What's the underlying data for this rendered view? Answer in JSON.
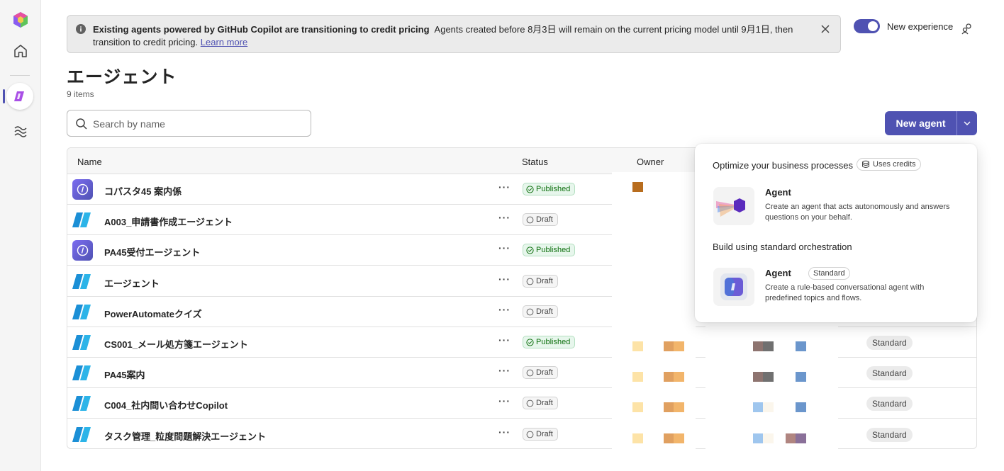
{
  "banner": {
    "title": "Existing agents powered by GitHub Copilot are transitioning to credit pricing",
    "message": "Agents created before 8月3日 will remain on the current pricing model until 9月1日, then transition to credit pricing.",
    "link": "Learn more"
  },
  "toggle": {
    "label": "New experience",
    "on": true
  },
  "page": {
    "title": "エージェント",
    "count": "9 items"
  },
  "search": {
    "placeholder": "Search by name"
  },
  "new_agent": {
    "label": "New agent"
  },
  "table": {
    "headers": {
      "name": "Name",
      "status": "Status",
      "owner": "Owner"
    },
    "rows": [
      {
        "name": "コパスタ45 案内係",
        "status": "Published",
        "kind": "pub",
        "orchestration": ""
      },
      {
        "name": "A003_申請書作成エージェント",
        "status": "Draft",
        "kind": "draft",
        "orchestration": ""
      },
      {
        "name": "PA45受付エージェント",
        "status": "Published",
        "kind": "pub",
        "orchestration": ""
      },
      {
        "name": "エージェント",
        "status": "Draft",
        "kind": "draft",
        "orchestration": ""
      },
      {
        "name": "PowerAutomateクイズ",
        "status": "Draft",
        "kind": "draft",
        "orchestration": ""
      },
      {
        "name": "CS001_メール処方箋エージェント",
        "status": "Published",
        "kind": "draft",
        "orchestration": "Standard"
      },
      {
        "name": "PA45案内",
        "status": "Draft",
        "kind": "draft",
        "orchestration": "Standard"
      },
      {
        "name": "C004_社内問い合わせCopilot",
        "status": "Draft",
        "kind": "draft",
        "orchestration": "Standard"
      },
      {
        "name": "タスク管理_粒度問題解決エージェント",
        "status": "Draft",
        "kind": "draft",
        "orchestration": "Standard"
      }
    ]
  },
  "popover": {
    "section1": "Optimize your business processes",
    "credits_badge": "Uses credits",
    "option1": {
      "title": "Agent",
      "desc": "Create an agent that acts autonomously and answers questions on your behalf."
    },
    "section2": "Build using standard orchestration",
    "option2": {
      "title": "Agent",
      "tag": "Standard",
      "desc": "Create a rule-based conversational agent with predefined topics and flows."
    }
  },
  "colors": {
    "accent": "#4f52b2",
    "published": "#0e700e"
  }
}
